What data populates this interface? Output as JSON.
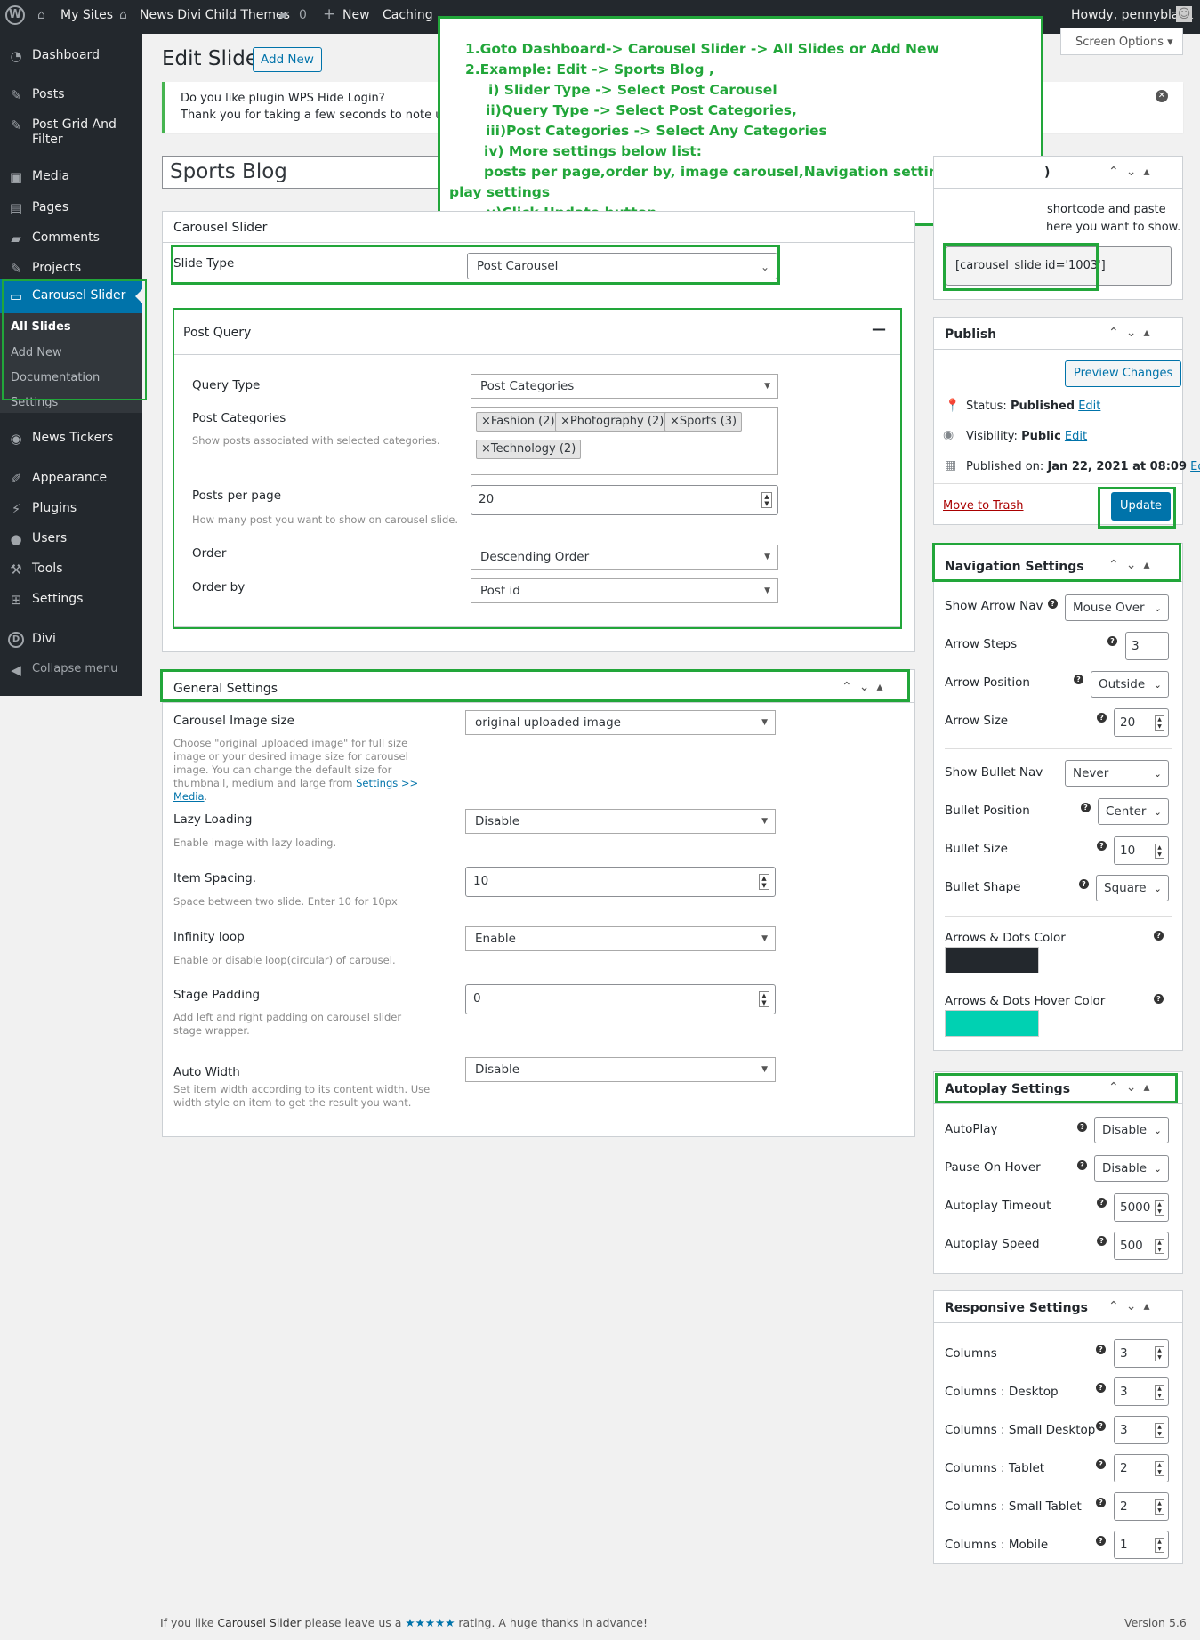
{
  "adminbar": {
    "my_sites": "My Sites",
    "site_name": "News Divi Child Themes",
    "comments_count": "0",
    "new_label": "New",
    "caching": "Caching",
    "howdy": "Howdy, pennyblack"
  },
  "sidebar": {
    "dashboard": "Dashboard",
    "posts": "Posts",
    "post_grid": "Post Grid And Filter",
    "media": "Media",
    "pages": "Pages",
    "comments": "Comments",
    "projects": "Projects",
    "carousel_slider": "Carousel Slider",
    "all_slides": "All Slides",
    "add_new": "Add New",
    "documentation": "Documentation",
    "settings_sub": "Settings",
    "news_tickers": "News Tickers",
    "appearance": "Appearance",
    "plugins": "Plugins",
    "users": "Users",
    "tools": "Tools",
    "settings": "Settings",
    "divi": "Divi",
    "collapse": "Collapse menu"
  },
  "page": {
    "title": "Edit Slide",
    "add_new_button": "Add New",
    "screen_options": "Screen Options",
    "notice_line1": "Do you like plugin WPS Hide Login?",
    "notice_line2": "Thank you for taking a few seconds to note us on",
    "post_title": "Sports Blog"
  },
  "annotation": {
    "line1": "1.Goto Dashboard-> Carousel Slider -> All Slides or Add New",
    "line2": "2.Example:    Edit -> Sports Blog ,",
    "line3": "i) Slider Type -> Select Post Carousel",
    "line4": "ii)Query Type -> Select Post Categories,",
    "line5": "iii)Post Categories -> Select Any Categories",
    "line6": "iv) More settings below list:",
    "line7": "posts per page,order by, image carousel,Navigation settings,Dots color, Auto",
    "line8": "play settings",
    "line9": "v)Click Update button"
  },
  "carousel_box": {
    "title": "Carousel Slider",
    "slide_type_label": "Slide Type",
    "slide_type_value": "Post Carousel"
  },
  "post_query": {
    "title": "Post Query",
    "collapse_symbol": "—",
    "query_type_label": "Query Type",
    "query_type_value": "Post Categories",
    "categories_label": "Post Categories",
    "categories_desc": "Show posts associated with selected categories.",
    "categories": [
      "Fashion (2)",
      "Photography (2)",
      "Sports (3)",
      "Technology (2)"
    ],
    "ppp_label": "Posts per page",
    "ppp_desc": "How many post you want to show on carousel slide.",
    "ppp_value": "20",
    "order_label": "Order",
    "order_value": "Descending Order",
    "orderby_label": "Order by",
    "orderby_value": "Post id"
  },
  "general": {
    "title": "General Settings",
    "image_size_label": "Carousel Image size",
    "image_size_value": "original uploaded image",
    "image_size_desc": "Choose \"original uploaded image\" for full size image or your desired image size for carousel image. You can change the default size for thumbnail, medium and large from",
    "image_size_link": "Settings >> Media",
    "lazy_label": "Lazy Loading",
    "lazy_desc": "Enable image with lazy loading.",
    "lazy_value": "Disable",
    "spacing_label": "Item Spacing.",
    "spacing_desc": "Space between two slide. Enter 10 for 10px",
    "spacing_value": "10",
    "loop_label": "Infinity loop",
    "loop_desc": "Enable or disable loop(circular) of carousel.",
    "loop_value": "Enable",
    "padding_label": "Stage Padding",
    "padding_desc": "Add left and right padding on carousel slider stage wrapper.",
    "padding_value": "0",
    "autowidth_label": "Auto Width",
    "autowidth_desc": "Set item width according to its content width. Use width style on item to get the result you want.",
    "autowidth_value": "Disable"
  },
  "shortcode_box": {
    "title_fragment": ")",
    "desc1": "shortcode and paste",
    "desc2": "here you want to show.",
    "shortcode": "[carousel_slide id='1003']"
  },
  "publish": {
    "title": "Publish",
    "preview": "Preview Changes",
    "status_label": "Status:",
    "status_value": "Published",
    "visibility_label": "Visibility:",
    "visibility_value": "Public",
    "published_on_label": "Published on:",
    "published_on_value": "Jan 22, 2021 at 08:09",
    "edit": "Edit",
    "trash": "Move to Trash",
    "update": "Update"
  },
  "navigation": {
    "title": "Navigation Settings",
    "show_arrow_label": "Show Arrow Nav",
    "show_arrow_value": "Mouse Over",
    "arrow_steps_label": "Arrow Steps",
    "arrow_steps_value": "3",
    "arrow_position_label": "Arrow Position",
    "arrow_position_value": "Outside",
    "arrow_size_label": "Arrow Size",
    "arrow_size_value": "20",
    "show_bullet_label": "Show Bullet Nav",
    "show_bullet_value": "Never",
    "bullet_position_label": "Bullet Position",
    "bullet_position_value": "Center",
    "bullet_size_label": "Bullet Size",
    "bullet_size_value": "10",
    "bullet_shape_label": "Bullet Shape",
    "bullet_shape_value": "Square",
    "dots_color_label": "Arrows & Dots Color",
    "dots_color": "#23282d",
    "dots_hover_label": "Arrows & Dots Hover Color",
    "dots_hover_color": "#00d1b2"
  },
  "autoplay": {
    "title": "Autoplay Settings",
    "autoplay_label": "AutoPlay",
    "autoplay_value": "Disable",
    "pause_label": "Pause On Hover",
    "pause_value": "Disable",
    "timeout_label": "Autoplay Timeout",
    "timeout_value": "5000",
    "speed_label": "Autoplay Speed",
    "speed_value": "500"
  },
  "responsive": {
    "title": "Responsive Settings",
    "columns_label": "Columns",
    "columns_value": "3",
    "desktop_label": "Columns : Desktop",
    "desktop_value": "3",
    "small_desktop_label": "Columns : Small Desktop",
    "small_desktop_value": "3",
    "tablet_label": "Columns : Tablet",
    "tablet_value": "2",
    "small_tablet_label": "Columns : Small Tablet",
    "small_tablet_value": "2",
    "mobile_label": "Columns : Mobile",
    "mobile_value": "1"
  },
  "footer": {
    "text_before": "If you like",
    "plugin_name": "Carousel Slider",
    "text_mid": "please leave us a",
    "stars": "★★★★★",
    "text_after": "rating. A huge thanks in advance!",
    "version": "Version 5.6"
  },
  "colors": {
    "annotation_green": "#22a63a",
    "wp_blue": "#0073aa",
    "admin_dark": "#23282d"
  }
}
